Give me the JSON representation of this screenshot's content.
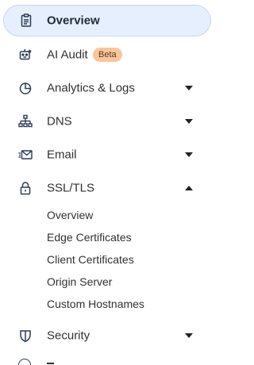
{
  "sidebar": {
    "items": [
      {
        "label": "Overview",
        "icon": "clipboard-icon",
        "active": true
      },
      {
        "label": "AI Audit",
        "icon": "robot-icon",
        "badge": "Beta"
      },
      {
        "label": "Analytics & Logs",
        "icon": "pie-chart-icon",
        "expanded": false
      },
      {
        "label": "DNS",
        "icon": "network-icon",
        "expanded": false
      },
      {
        "label": "Email",
        "icon": "email-icon",
        "expanded": false
      },
      {
        "label": "SSL/TLS",
        "icon": "lock-icon",
        "expanded": true,
        "children": [
          "Overview",
          "Edge Certificates",
          "Client Certificates",
          "Origin Server",
          "Custom Hostnames"
        ]
      },
      {
        "label": "Security",
        "icon": "shield-icon",
        "expanded": false
      }
    ]
  },
  "colors": {
    "active_bg": "#e6effe",
    "badge_bg": "#f9c69a",
    "text": "#313131"
  }
}
